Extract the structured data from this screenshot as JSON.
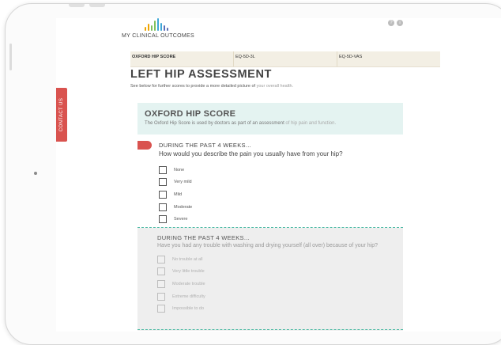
{
  "app": {
    "logo_text": "MY CLINICAL OUTCOMES",
    "brand_colors": [
      "#f0a500",
      "#7fc15e",
      "#3fa7d6",
      "#5a6fb8"
    ]
  },
  "contact_tab": {
    "label": "CONTACT US"
  },
  "top_icons": [
    "help-icon",
    "info-icon"
  ],
  "tabs": [
    {
      "label": "OXFORD  HIP SCORE",
      "active": true
    },
    {
      "label": "EQ-5D-3L",
      "active": false
    },
    {
      "label": "EQ-5D-VAS",
      "active": false
    }
  ],
  "page": {
    "title": "LEFT HIP ASSESSMENT",
    "subtitle_main": "See below for further scores to provide a more detailed picture of",
    "subtitle_muted": "your overall health."
  },
  "score": {
    "title": "OXFORD HIP SCORE",
    "desc_main": "The Oxford Hip Score is used by doctors as part of an assessment",
    "desc_muted": "of hip pain and function."
  },
  "question1": {
    "heading": "DURING THE PAST 4 WEEKS...",
    "text": "How would you describe the pain you usually have from your hip?",
    "options": [
      "None",
      "Very mild",
      "Mild",
      "Moderate",
      "Severe"
    ]
  },
  "question2": {
    "heading": "DURING THE PAST 4 WEEKS...",
    "text": "Have you had any trouble with washing and drying yourself (all over) because of your hip?",
    "options": [
      "No trouble at all",
      "Very little trouble",
      "Moderate trouble",
      "Extreme difficulty",
      "Impossible to do"
    ]
  },
  "colors": {
    "accent_red": "#d9534f",
    "teal": "#52bba6",
    "score_bg": "#e4f3f1",
    "tabs_bg": "#f3efe4"
  }
}
